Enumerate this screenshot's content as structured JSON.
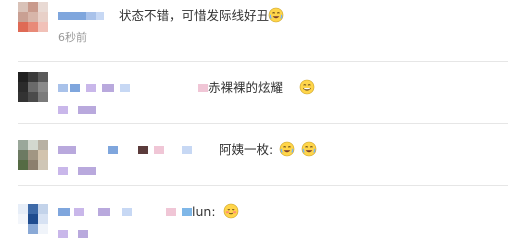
{
  "comments": [
    {
      "text": "状态不错，可惜发际线好丑",
      "time": "6秒前",
      "emojis": [
        "laugh-cry-icon"
      ]
    },
    {
      "text": "赤裸裸的炫耀",
      "emojis": [
        "grin-icon"
      ]
    },
    {
      "text": "阿姨一枚:",
      "emojis": [
        "laugh-cry-icon",
        "laugh-cry-icon"
      ]
    },
    {
      "text": "lun:",
      "emojis": [
        "shy-smile-icon"
      ]
    }
  ],
  "colors": {
    "mosaic_blue": "#7fa6dd",
    "mosaic_purple": "#b9a9dd",
    "mosaic_pink": "#f0c6d6",
    "mosaic_dark": "#5b3b3b",
    "divider": "#e6e6e6",
    "emoji_yellow": "#ffd54a"
  }
}
